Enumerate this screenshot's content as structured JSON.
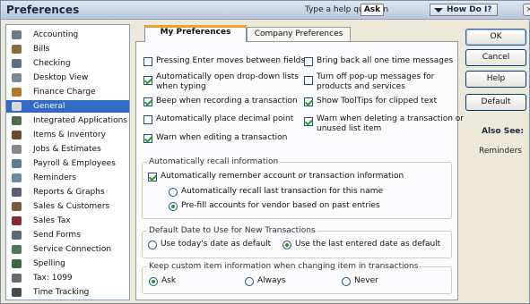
{
  "window": {
    "title": "Preferences"
  },
  "help": {
    "prompt": "Type a help question",
    "ask_label": "Ask",
    "how_do_i_label": "How Do I?",
    "close_glyph": "×"
  },
  "sidebar": {
    "items": [
      {
        "label": "Accounting",
        "icon": "accounting-icon",
        "color": "#6b7b8c"
      },
      {
        "label": "Bills",
        "icon": "bills-icon",
        "color": "#8a6a3b"
      },
      {
        "label": "Checking",
        "icon": "checking-icon",
        "color": "#5a6f8a"
      },
      {
        "label": "Desktop View",
        "icon": "desktop-view-icon",
        "color": "#7a8a9a"
      },
      {
        "label": "Finance Charge",
        "icon": "finance-charge-icon",
        "color": "#b07a2a"
      },
      {
        "label": "General",
        "icon": "general-icon",
        "color": "#d9d9d9",
        "selected": true
      },
      {
        "label": "Integrated Applications",
        "icon": "integrated-applications-icon",
        "color": "#4a6a4a"
      },
      {
        "label": "Items & Inventory",
        "icon": "items-inventory-icon",
        "color": "#6a4a2a"
      },
      {
        "label": "Jobs & Estimates",
        "icon": "jobs-estimates-icon",
        "color": "#888888"
      },
      {
        "label": "Payroll & Employees",
        "icon": "payroll-employees-icon",
        "color": "#5a7a9a"
      },
      {
        "label": "Reminders",
        "icon": "reminders-icon",
        "color": "#6a8aaa"
      },
      {
        "label": "Reports & Graphs",
        "icon": "reports-graphs-icon",
        "color": "#5a5a7a"
      },
      {
        "label": "Sales & Customers",
        "icon": "sales-customers-icon",
        "color": "#7a5a3a"
      },
      {
        "label": "Sales Tax",
        "icon": "sales-tax-icon",
        "color": "#8a2a2a"
      },
      {
        "label": "Send Forms",
        "icon": "send-forms-icon",
        "color": "#5a6a7a"
      },
      {
        "label": "Service Connection",
        "icon": "service-connection-icon",
        "color": "#4a7a5a"
      },
      {
        "label": "Spelling",
        "icon": "spelling-icon",
        "color": "#3a6a3a"
      },
      {
        "label": "Tax: 1099",
        "icon": "tax-1099-icon",
        "color": "#6a6a6a"
      },
      {
        "label": "Time Tracking",
        "icon": "time-tracking-icon",
        "color": "#4a4a4a"
      }
    ]
  },
  "tabs": {
    "my_preferences": "My Preferences",
    "company_preferences": "Company Preferences"
  },
  "options": {
    "pressing_enter": {
      "label": "Pressing Enter moves between fields",
      "checked": false
    },
    "auto_dropdown": {
      "label": "Automatically open drop-down lists\nwhen typing",
      "checked": true
    },
    "beep": {
      "label": "Beep when recording a transaction",
      "checked": true
    },
    "decimal": {
      "label": "Automatically place decimal point",
      "checked": false
    },
    "warn_editing": {
      "label": "Warn when editing a transaction",
      "checked": true
    },
    "bring_back": {
      "label": "Bring back all one time messages",
      "checked": false
    },
    "turn_off_popup": {
      "label": "Turn off pop-up messages for\nproducts and services",
      "checked": false
    },
    "show_tooltips": {
      "label": "Show ToolTips for clipped text",
      "checked": true
    },
    "warn_deleting": {
      "label": "Warn when deleting a transaction or\nunused list item",
      "checked": true
    }
  },
  "recall": {
    "title": "Automatically recall information",
    "remember": {
      "label": "Automatically remember account or transaction information",
      "checked": true
    },
    "recall_last": {
      "label": "Automatically recall last transaction for this name",
      "selected": false
    },
    "prefill": {
      "label": "Pre-fill accounts for vendor based on past entries",
      "selected": true
    }
  },
  "default_date": {
    "title": "Default Date to Use for New Transactions",
    "today": {
      "label": "Use today's date as default",
      "selected": false
    },
    "last_entered": {
      "label": "Use the last entered date as default",
      "selected": true
    }
  },
  "custom_item": {
    "title": "Keep custom item information when changing item in transactions",
    "ask": {
      "label": "Ask",
      "selected": true
    },
    "always": {
      "label": "Always",
      "selected": false
    },
    "never": {
      "label": "Never",
      "selected": false
    }
  },
  "buttons": {
    "ok": "OK",
    "cancel": "Cancel",
    "help": "Help",
    "default": "Default"
  },
  "also_see": {
    "title": "Also See:",
    "reminders": "Reminders"
  },
  "colors": {
    "selection": "#316ac5",
    "check": "#21a121",
    "tab_accent": "#f0a030"
  }
}
